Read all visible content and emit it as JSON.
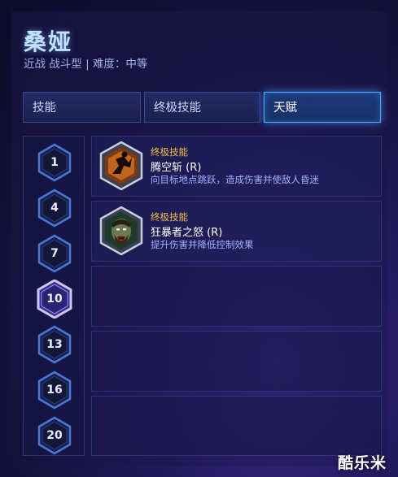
{
  "hero": {
    "name": "桑娅",
    "subtitle": "近战 战斗型 | 难度：中等"
  },
  "tabs": [
    {
      "label": "技能",
      "active": false
    },
    {
      "label": "终极技能",
      "active": false
    },
    {
      "label": "天赋",
      "active": true
    }
  ],
  "tiers": [
    {
      "level": "1",
      "selected": false
    },
    {
      "level": "4",
      "selected": false
    },
    {
      "level": "7",
      "selected": false
    },
    {
      "level": "10",
      "selected": true
    },
    {
      "level": "13",
      "selected": false
    },
    {
      "level": "16",
      "selected": false
    },
    {
      "level": "20",
      "selected": false
    }
  ],
  "talents": [
    {
      "category": "终极技能",
      "name": "腾空斩 (R)",
      "description": "向目标地点跳跃，造成伤害并使敌人昏迷",
      "icon": "leap-attack-icon"
    },
    {
      "category": "终极技能",
      "name": "狂暴者之怒 (R)",
      "description": "提升伤害并降低控制效果",
      "icon": "berserker-rage-icon"
    }
  ],
  "watermark": "酷乐米",
  "colors": {
    "accent_blue": "#4ea6ff",
    "category_gold": "#f0c050",
    "selected_tier": "#b9a6ff"
  }
}
